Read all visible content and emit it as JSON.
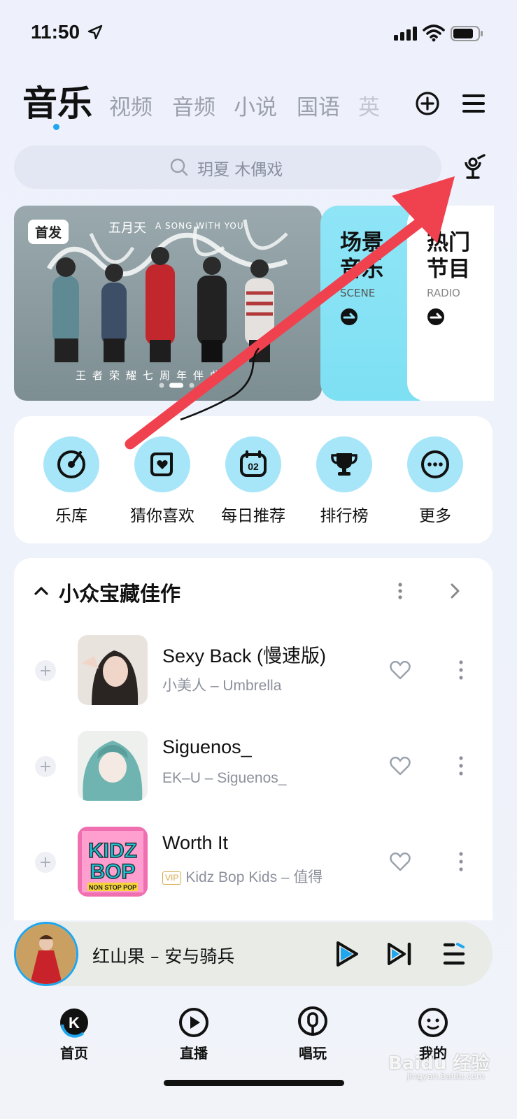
{
  "status_bar": {
    "time": "11:50"
  },
  "tabs": [
    {
      "label": "音乐",
      "active": true
    },
    {
      "label": "视频"
    },
    {
      "label": "音频"
    },
    {
      "label": "小说"
    },
    {
      "label": "国语"
    },
    {
      "label": "英"
    }
  ],
  "search": {
    "placeholder": "玥夏 木偶戏"
  },
  "banner": {
    "badge": "首发",
    "artist": "五月天",
    "english": "A SONG WITH YOU",
    "subtitle": "王者荣耀七周年伴曲"
  },
  "cards": [
    {
      "title": "场景音乐",
      "subtitle": "SCENE"
    },
    {
      "title": "热门节目",
      "subtitle": "RADIO"
    }
  ],
  "quick_nav": [
    {
      "label": "乐库",
      "icon": "disc-icon"
    },
    {
      "label": "猜你喜欢",
      "icon": "heart-box-icon"
    },
    {
      "label": "每日推荐",
      "icon": "calendar-02-icon",
      "badge": "02"
    },
    {
      "label": "排行榜",
      "icon": "trophy-icon"
    },
    {
      "label": "更多",
      "icon": "more-icon"
    }
  ],
  "section": {
    "title": "小众宝藏佳作"
  },
  "songs": [
    {
      "title": "Sexy Back (慢速版)",
      "artist": "小美人 – Umbrella",
      "vip": false
    },
    {
      "title": "Siguenos_",
      "artist": "EK–U – Siguenos_",
      "vip": false
    },
    {
      "title": "Worth It",
      "artist": "Kidz Bop Kids – 值得",
      "vip": true,
      "vip_label": "VIP"
    }
  ],
  "kidz_cover": {
    "line1": "KIDZ",
    "line2": "BOP",
    "line3": "NON STOP POP"
  },
  "player": {
    "now_playing": "红山果 – 安与骑兵"
  },
  "bottom_nav": [
    {
      "label": "首页",
      "icon": "home-k-icon",
      "active": true
    },
    {
      "label": "直播",
      "icon": "live-play-icon"
    },
    {
      "label": "唱玩",
      "icon": "sing-mic-icon"
    },
    {
      "label": "我的",
      "icon": "profile-face-icon"
    }
  ],
  "watermark": {
    "text": "Baidu 经验",
    "sub": "jingyan.baidu.com"
  },
  "colors": {
    "accent": "#1fa6ee",
    "annotation_arrow": "#f0414f",
    "quick_circle": "#a7e6f8",
    "scene_card": "#8fe5f6"
  }
}
